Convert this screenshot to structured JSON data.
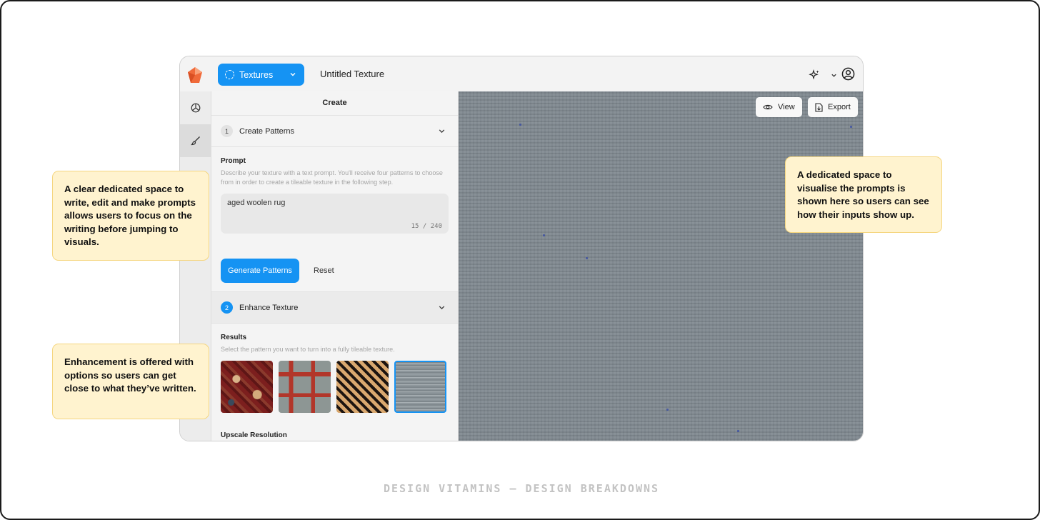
{
  "header": {
    "mode_button_label": "Textures",
    "document_title": "Untitled Texture"
  },
  "panel": {
    "title": "Create",
    "step1": {
      "number": "1",
      "label": "Create Patterns"
    },
    "prompt": {
      "label": "Prompt",
      "description": "Describe your texture with a text prompt. You'll receive four patterns to choose from in order to create a tileable texture in the following step.",
      "value": "aged woolen rug",
      "counter": "15 / 240"
    },
    "generate_button_label": "Generate Patterns",
    "reset_button_label": "Reset",
    "step2": {
      "number": "2",
      "label": "Enhance Texture"
    },
    "results": {
      "label": "Results",
      "description": "Select the pattern you want to turn into a fully tileable texture.",
      "selected_index": 3
    },
    "upscale_label": "Upscale Resolution"
  },
  "preview": {
    "view_label": "View",
    "export_label": "Export"
  },
  "callouts": {
    "left_top": "A clear dedicated space to write, edit and make prompts allows users to focus on the writing before jumping to visuals.",
    "left_bottom": "Enhancement is offered with options so users can get close to what they’ve written.",
    "right": "A dedicated space to visualise the prompts is shown here so users can see how their inputs show up."
  },
  "footer": "DESIGN VITAMINS – DESIGN BREAKDOWNS",
  "colors": {
    "accent": "#1593f3",
    "callout_bg": "#fff3cf",
    "callout_border": "#f5d680"
  },
  "icons": {
    "logo": "gem-logo-icon",
    "sidebar": [
      "palette-icon",
      "brush-icon",
      "settings-icon"
    ],
    "toolbar": [
      "sparkle-icon",
      "chevron-down-icon",
      "account-icon"
    ]
  }
}
